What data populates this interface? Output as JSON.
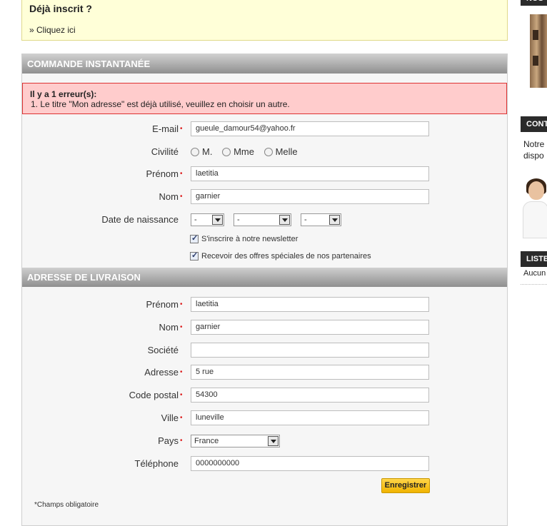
{
  "already": {
    "title": "Déjà inscrit ?",
    "link": "» Cliquez ici"
  },
  "order": {
    "heading": "COMMANDE INSTANTANÉE",
    "error_title": "Il y a 1 erreur(s):",
    "error_msg": "1.  Le titre \"Mon adresse\" est déjà utilisé, veuillez en choisir un autre.",
    "email_label": "E-mail",
    "email_value": "gueule_damour54@yahoo.fr",
    "civility_label": "Civilité",
    "civility_options": [
      "M.",
      "Mme",
      "Melle"
    ],
    "firstname_label": "Prénom",
    "firstname_value": "laetitia",
    "lastname_label": "Nom",
    "lastname_value": "garnier",
    "birth_label": "Date de naissance",
    "birth_day": "-",
    "birth_month": "-",
    "birth_year": "-",
    "newsletter_label": "S'inscrire à notre newsletter",
    "partners_label": "Recevoir des offres spéciales de nos partenaires"
  },
  "delivery": {
    "heading": "ADRESSE DE LIVRAISON",
    "firstname_label": "Prénom",
    "firstname_value": "laetitia",
    "lastname_label": "Nom",
    "lastname_value": "garnier",
    "company_label": "Société",
    "company_value": "",
    "address_label": "Adresse",
    "address_value": "5 rue",
    "zip_label": "Code postal",
    "zip_value": "54300",
    "city_label": "Ville",
    "city_value": "luneville",
    "country_label": "Pays",
    "country_value": "France",
    "phone_label": "Téléphone",
    "phone_value": "0000000000",
    "submit": "Enregistrer",
    "note": "*Champs obligatoire"
  },
  "sidebar": {
    "head1": "NOS",
    "head2": "CONTACT",
    "text1": "Notre",
    "text2": "dispo",
    "head3": "LISTE",
    "text3": "Aucun p"
  },
  "colors": {
    "accent_button": "#f0b400",
    "error_bg": "#ffcccc",
    "required": "#dd2222"
  }
}
